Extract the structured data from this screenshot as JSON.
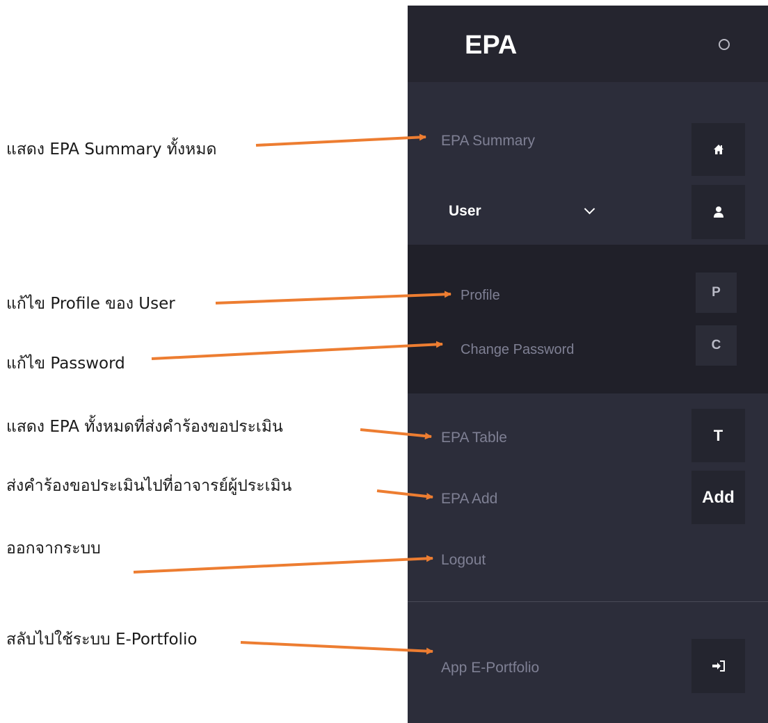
{
  "annotations": {
    "summary": "แสดง EPA Summary ทั้งหมด",
    "profile": "แก้ไข Profile ของ User",
    "password": "แก้ไข Password",
    "table": "แสดง EPA ทั้งหมดที่ส่งคำร้องขอประเมิน",
    "add": "ส่งคำร้องขอประเมินไปที่อาจารย์ผู้ประเมิน",
    "logout": "ออกจากระบบ",
    "switch": "สลับไปใช้ระบบ E-Portfolio"
  },
  "sidebar": {
    "brand": "EPA",
    "items": {
      "summary": {
        "label": "EPA Summary",
        "icon": "home-icon"
      },
      "user": {
        "label": "User",
        "icon": "user-icon",
        "expanded": true
      },
      "profile": {
        "label": "Profile",
        "icon_text": "P"
      },
      "password": {
        "label": "Change Password",
        "icon_text": "C"
      },
      "table": {
        "label": "EPA Table",
        "icon_text": "T"
      },
      "add": {
        "label": "EPA Add",
        "icon_text": "Add"
      },
      "logout": {
        "label": "Logout"
      },
      "portfolio": {
        "label": "App E-Portfolio",
        "icon": "sign-in-icon"
      }
    }
  },
  "colors": {
    "sidebar_bg": "#2c2d3a",
    "header_bg": "#25252f",
    "submenu_bg": "#202029",
    "muted_text": "#7f8094",
    "arrow": "#ed7d31"
  }
}
